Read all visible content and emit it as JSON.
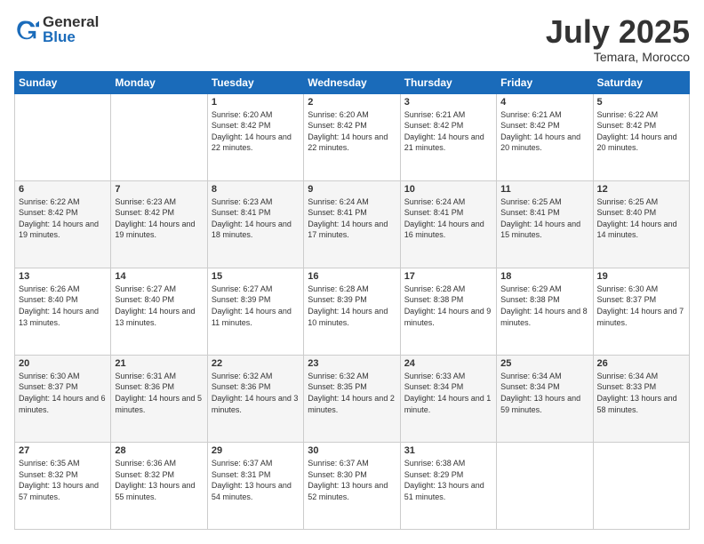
{
  "header": {
    "logo_general": "General",
    "logo_blue": "Blue",
    "month": "July 2025",
    "location": "Temara, Morocco"
  },
  "days_of_week": [
    "Sunday",
    "Monday",
    "Tuesday",
    "Wednesday",
    "Thursday",
    "Friday",
    "Saturday"
  ],
  "weeks": [
    [
      {
        "day": "",
        "sunrise": "",
        "sunset": "",
        "daylight": ""
      },
      {
        "day": "",
        "sunrise": "",
        "sunset": "",
        "daylight": ""
      },
      {
        "day": "1",
        "sunrise": "Sunrise: 6:20 AM",
        "sunset": "Sunset: 8:42 PM",
        "daylight": "Daylight: 14 hours and 22 minutes."
      },
      {
        "day": "2",
        "sunrise": "Sunrise: 6:20 AM",
        "sunset": "Sunset: 8:42 PM",
        "daylight": "Daylight: 14 hours and 22 minutes."
      },
      {
        "day": "3",
        "sunrise": "Sunrise: 6:21 AM",
        "sunset": "Sunset: 8:42 PM",
        "daylight": "Daylight: 14 hours and 21 minutes."
      },
      {
        "day": "4",
        "sunrise": "Sunrise: 6:21 AM",
        "sunset": "Sunset: 8:42 PM",
        "daylight": "Daylight: 14 hours and 20 minutes."
      },
      {
        "day": "5",
        "sunrise": "Sunrise: 6:22 AM",
        "sunset": "Sunset: 8:42 PM",
        "daylight": "Daylight: 14 hours and 20 minutes."
      }
    ],
    [
      {
        "day": "6",
        "sunrise": "Sunrise: 6:22 AM",
        "sunset": "Sunset: 8:42 PM",
        "daylight": "Daylight: 14 hours and 19 minutes."
      },
      {
        "day": "7",
        "sunrise": "Sunrise: 6:23 AM",
        "sunset": "Sunset: 8:42 PM",
        "daylight": "Daylight: 14 hours and 19 minutes."
      },
      {
        "day": "8",
        "sunrise": "Sunrise: 6:23 AM",
        "sunset": "Sunset: 8:41 PM",
        "daylight": "Daylight: 14 hours and 18 minutes."
      },
      {
        "day": "9",
        "sunrise": "Sunrise: 6:24 AM",
        "sunset": "Sunset: 8:41 PM",
        "daylight": "Daylight: 14 hours and 17 minutes."
      },
      {
        "day": "10",
        "sunrise": "Sunrise: 6:24 AM",
        "sunset": "Sunset: 8:41 PM",
        "daylight": "Daylight: 14 hours and 16 minutes."
      },
      {
        "day": "11",
        "sunrise": "Sunrise: 6:25 AM",
        "sunset": "Sunset: 8:41 PM",
        "daylight": "Daylight: 14 hours and 15 minutes."
      },
      {
        "day": "12",
        "sunrise": "Sunrise: 6:25 AM",
        "sunset": "Sunset: 8:40 PM",
        "daylight": "Daylight: 14 hours and 14 minutes."
      }
    ],
    [
      {
        "day": "13",
        "sunrise": "Sunrise: 6:26 AM",
        "sunset": "Sunset: 8:40 PM",
        "daylight": "Daylight: 14 hours and 13 minutes."
      },
      {
        "day": "14",
        "sunrise": "Sunrise: 6:27 AM",
        "sunset": "Sunset: 8:40 PM",
        "daylight": "Daylight: 14 hours and 13 minutes."
      },
      {
        "day": "15",
        "sunrise": "Sunrise: 6:27 AM",
        "sunset": "Sunset: 8:39 PM",
        "daylight": "Daylight: 14 hours and 11 minutes."
      },
      {
        "day": "16",
        "sunrise": "Sunrise: 6:28 AM",
        "sunset": "Sunset: 8:39 PM",
        "daylight": "Daylight: 14 hours and 10 minutes."
      },
      {
        "day": "17",
        "sunrise": "Sunrise: 6:28 AM",
        "sunset": "Sunset: 8:38 PM",
        "daylight": "Daylight: 14 hours and 9 minutes."
      },
      {
        "day": "18",
        "sunrise": "Sunrise: 6:29 AM",
        "sunset": "Sunset: 8:38 PM",
        "daylight": "Daylight: 14 hours and 8 minutes."
      },
      {
        "day": "19",
        "sunrise": "Sunrise: 6:30 AM",
        "sunset": "Sunset: 8:37 PM",
        "daylight": "Daylight: 14 hours and 7 minutes."
      }
    ],
    [
      {
        "day": "20",
        "sunrise": "Sunrise: 6:30 AM",
        "sunset": "Sunset: 8:37 PM",
        "daylight": "Daylight: 14 hours and 6 minutes."
      },
      {
        "day": "21",
        "sunrise": "Sunrise: 6:31 AM",
        "sunset": "Sunset: 8:36 PM",
        "daylight": "Daylight: 14 hours and 5 minutes."
      },
      {
        "day": "22",
        "sunrise": "Sunrise: 6:32 AM",
        "sunset": "Sunset: 8:36 PM",
        "daylight": "Daylight: 14 hours and 3 minutes."
      },
      {
        "day": "23",
        "sunrise": "Sunrise: 6:32 AM",
        "sunset": "Sunset: 8:35 PM",
        "daylight": "Daylight: 14 hours and 2 minutes."
      },
      {
        "day": "24",
        "sunrise": "Sunrise: 6:33 AM",
        "sunset": "Sunset: 8:34 PM",
        "daylight": "Daylight: 14 hours and 1 minute."
      },
      {
        "day": "25",
        "sunrise": "Sunrise: 6:34 AM",
        "sunset": "Sunset: 8:34 PM",
        "daylight": "Daylight: 13 hours and 59 minutes."
      },
      {
        "day": "26",
        "sunrise": "Sunrise: 6:34 AM",
        "sunset": "Sunset: 8:33 PM",
        "daylight": "Daylight: 13 hours and 58 minutes."
      }
    ],
    [
      {
        "day": "27",
        "sunrise": "Sunrise: 6:35 AM",
        "sunset": "Sunset: 8:32 PM",
        "daylight": "Daylight: 13 hours and 57 minutes."
      },
      {
        "day": "28",
        "sunrise": "Sunrise: 6:36 AM",
        "sunset": "Sunset: 8:32 PM",
        "daylight": "Daylight: 13 hours and 55 minutes."
      },
      {
        "day": "29",
        "sunrise": "Sunrise: 6:37 AM",
        "sunset": "Sunset: 8:31 PM",
        "daylight": "Daylight: 13 hours and 54 minutes."
      },
      {
        "day": "30",
        "sunrise": "Sunrise: 6:37 AM",
        "sunset": "Sunset: 8:30 PM",
        "daylight": "Daylight: 13 hours and 52 minutes."
      },
      {
        "day": "31",
        "sunrise": "Sunrise: 6:38 AM",
        "sunset": "Sunset: 8:29 PM",
        "daylight": "Daylight: 13 hours and 51 minutes."
      },
      {
        "day": "",
        "sunrise": "",
        "sunset": "",
        "daylight": ""
      },
      {
        "day": "",
        "sunrise": "",
        "sunset": "",
        "daylight": ""
      }
    ]
  ]
}
